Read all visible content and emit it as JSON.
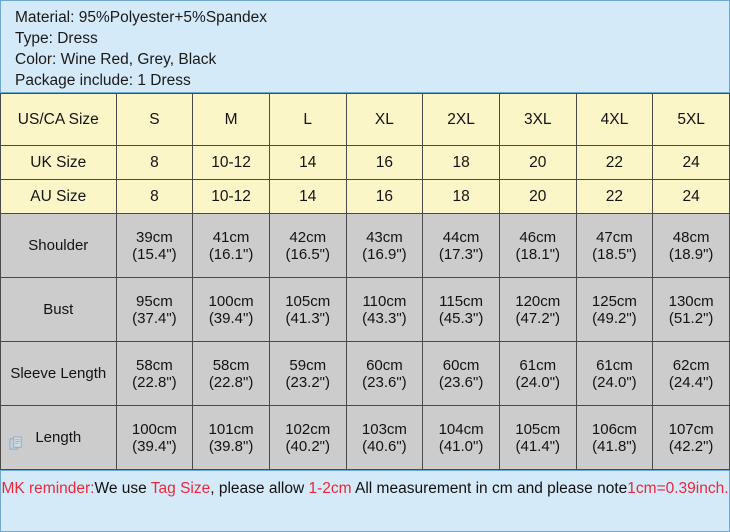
{
  "info": {
    "lines": [
      "Material: 95%Polyester+5%Spandex",
      "Type: Dress",
      "Color: Wine Red, Grey, Black",
      "Package include: 1 Dress"
    ]
  },
  "table": {
    "header_label": "US/CA Size",
    "sizes": [
      "S",
      "M",
      "L",
      "XL",
      "2XL",
      "3XL",
      "4XL",
      "5XL"
    ],
    "size_rows": [
      {
        "label": "UK Size",
        "values": [
          "8",
          "10-12",
          "14",
          "16",
          "18",
          "20",
          "22",
          "24"
        ]
      },
      {
        "label": "AU Size",
        "values": [
          "8",
          "10-12",
          "14",
          "16",
          "18",
          "20",
          "22",
          "24"
        ]
      }
    ],
    "measure_rows": [
      {
        "label": "Shoulder",
        "cm": [
          "39cm",
          "41cm",
          "42cm",
          "43cm",
          "44cm",
          "46cm",
          "47cm",
          "48cm"
        ],
        "inch": [
          "(15.4\")",
          "(16.1\")",
          "(16.5\")",
          "(16.9\")",
          "(17.3\")",
          "(18.1\")",
          "(18.5\")",
          "(18.9\")"
        ]
      },
      {
        "label": "Bust",
        "cm": [
          "95cm",
          "100cm",
          "105cm",
          "110cm",
          "115cm",
          "120cm",
          "125cm",
          "130cm"
        ],
        "inch": [
          "(37.4\")",
          "(39.4\")",
          "(41.3\")",
          "(43.3\")",
          "(45.3\")",
          "(47.2\")",
          "(49.2\")",
          "(51.2\")"
        ]
      },
      {
        "label": "Sleeve Length",
        "cm": [
          "58cm",
          "58cm",
          "59cm",
          "60cm",
          "60cm",
          "61cm",
          "61cm",
          "62cm"
        ],
        "inch": [
          "(22.8\")",
          "(22.8\")",
          "(23.2\")",
          "(23.6\")",
          "(23.6\")",
          "(24.0\")",
          "(24.0\")",
          "(24.4\")"
        ]
      },
      {
        "label": "Length",
        "cm": [
          "100cm",
          "101cm",
          "102cm",
          "103cm",
          "104cm",
          "105cm",
          "106cm",
          "107cm"
        ],
        "inch": [
          "(39.4\")",
          "(39.8\")",
          "(40.2\")",
          "(40.6\")",
          "(41.0\")",
          "(41.4\")",
          "(41.8\")",
          "(42.2\")"
        ]
      }
    ]
  },
  "note": {
    "seg1_red": "MK reminder:",
    "seg2_black": "We use ",
    "seg3_red": "Tag Size",
    "seg4_black": ", please allow ",
    "seg5_red": "1-2cm",
    "seg6_black": " All measurement in cm and please ",
    "seg7_black": "note",
    "seg8_red": "1cm=0.39inch."
  },
  "colors": {
    "info_bg": "#d4eaf8",
    "info_border": "#6fa8d0",
    "header_row_bg": "#fbf6c8",
    "measure_row_bg": "#cccccc",
    "grid_line": "#4a4a4a",
    "accent_red": "#e8283c",
    "text": "#111111"
  },
  "icons": {
    "watermark": "document-copy-icon"
  }
}
